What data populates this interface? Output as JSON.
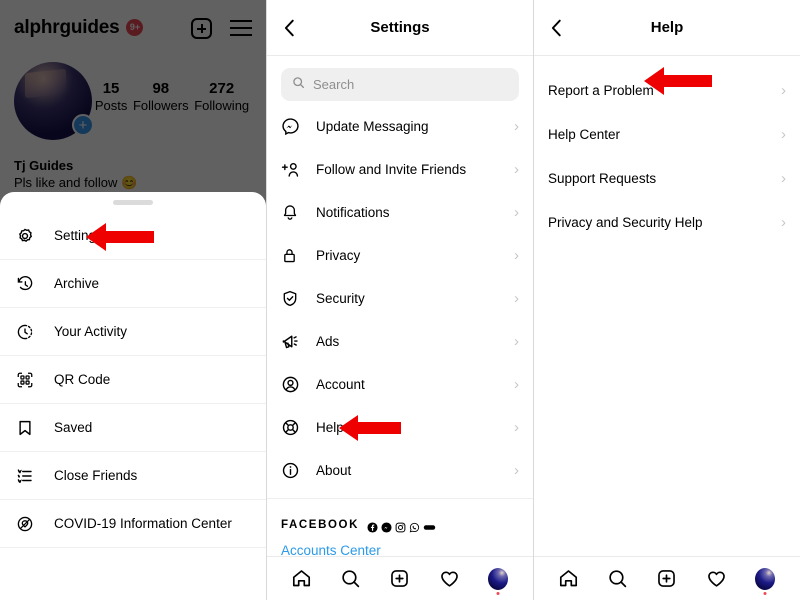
{
  "panels": [
    {
      "id": "profile-with-menu",
      "profile": {
        "username": "alphrguides",
        "badge": "9+",
        "plus_icon": "plus-box-icon",
        "menu_icon": "hamburger-menu-icon",
        "avatar_plus": "+",
        "stats": [
          {
            "num": "15",
            "label": "Posts"
          },
          {
            "num": "98",
            "label": "Followers"
          },
          {
            "num": "272",
            "label": "Following"
          }
        ],
        "display_name": "Tj Guides",
        "bio": "Pls like and follow 😊"
      },
      "sheet": {
        "items": [
          {
            "label": "Settings",
            "icon": "gear-icon",
            "highlighted": true
          },
          {
            "label": "Archive",
            "icon": "archive-clock-icon",
            "highlighted": false
          },
          {
            "label": "Your Activity",
            "icon": "activity-clock-icon",
            "highlighted": false
          },
          {
            "label": "QR Code",
            "icon": "qr-code-icon",
            "highlighted": false
          },
          {
            "label": "Saved",
            "icon": "bookmark-icon",
            "highlighted": false
          },
          {
            "label": "Close Friends",
            "icon": "close-friends-list-icon",
            "highlighted": false
          },
          {
            "label": "COVID-19 Information Center",
            "icon": "covid-info-icon",
            "highlighted": false
          }
        ]
      }
    },
    {
      "id": "settings",
      "header": {
        "title": "Settings",
        "back_icon": "chevron-left-icon"
      },
      "search": {
        "placeholder": "Search",
        "value": "",
        "icon": "search-icon"
      },
      "items": [
        {
          "label": "Update Messaging",
          "icon": "messenger-icon",
          "highlighted": false
        },
        {
          "label": "Follow and Invite Friends",
          "icon": "add-person-icon",
          "highlighted": false
        },
        {
          "label": "Notifications",
          "icon": "bell-icon",
          "highlighted": false
        },
        {
          "label": "Privacy",
          "icon": "lock-icon",
          "highlighted": false
        },
        {
          "label": "Security",
          "icon": "shield-check-icon",
          "highlighted": false
        },
        {
          "label": "Ads",
          "icon": "megaphone-icon",
          "highlighted": false
        },
        {
          "label": "Account",
          "icon": "account-circle-icon",
          "highlighted": false
        },
        {
          "label": "Help",
          "icon": "life-ring-icon",
          "highlighted": true
        },
        {
          "label": "About",
          "icon": "info-circle-icon",
          "highlighted": false
        }
      ],
      "facebook_block": {
        "word": "FACEBOOK",
        "icons": [
          "facebook-icon",
          "messenger-icon",
          "instagram-icon",
          "whatsapp-icon",
          "portal-icon"
        ],
        "link": "Accounts Center"
      }
    },
    {
      "id": "help",
      "header": {
        "title": "Help",
        "back_icon": "chevron-left-icon"
      },
      "items": [
        {
          "label": "Report a Problem",
          "highlighted": true
        },
        {
          "label": "Help Center",
          "highlighted": false
        },
        {
          "label": "Support Requests",
          "highlighted": false
        },
        {
          "label": "Privacy and Security Help",
          "highlighted": false
        }
      ]
    }
  ],
  "tabbar": {
    "items": [
      {
        "name": "home-icon",
        "label": "Home"
      },
      {
        "name": "search-icon",
        "label": "Search"
      },
      {
        "name": "add-post-icon",
        "label": "Create"
      },
      {
        "name": "heart-icon",
        "label": "Activity"
      },
      {
        "name": "profile-avatar",
        "label": "Profile"
      }
    ]
  },
  "annotations": {
    "arrow_color": "#ee0000",
    "arrows": [
      {
        "points_to": "Settings",
        "direction": "left"
      },
      {
        "points_to": "Help",
        "direction": "left"
      },
      {
        "points_to": "Report a Problem",
        "direction": "left"
      }
    ]
  },
  "colors": {
    "accent_blue": "#3897f0",
    "link_blue": "#2b9ae8",
    "badge_red": "#ed4956",
    "arrow_red": "#ee0000",
    "search_bg": "#efefef",
    "divider": "#efefef",
    "overlay": "rgba(0,0,0,0.62)"
  }
}
